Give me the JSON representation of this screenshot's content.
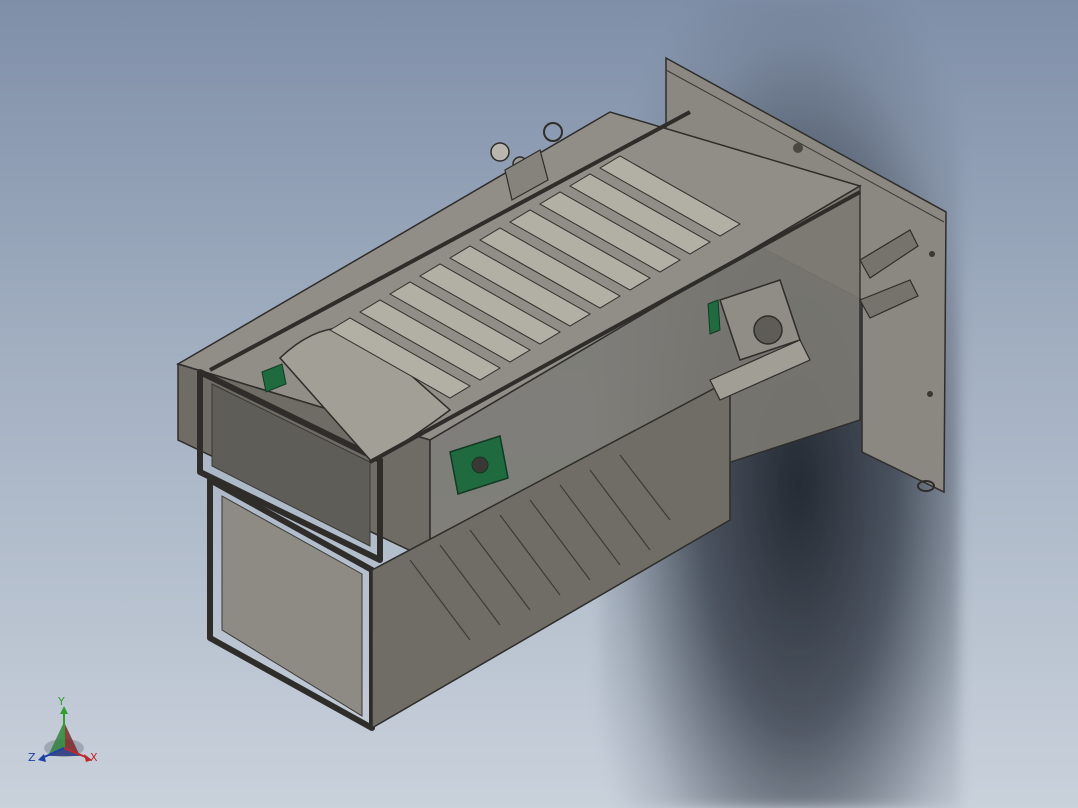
{
  "viewport": {
    "background_top": "#7f8fa8",
    "background_bottom": "#c9d1db",
    "part_color": "#7a7871",
    "edge_color": "#2f2d2a",
    "accent_green": "#1f6b3f"
  },
  "triad": {
    "x_label": "X",
    "y_label": "Y",
    "z_label": "Z",
    "x_color": "#c0262b",
    "y_color": "#2e9e2e",
    "z_color": "#1f3fa8"
  }
}
